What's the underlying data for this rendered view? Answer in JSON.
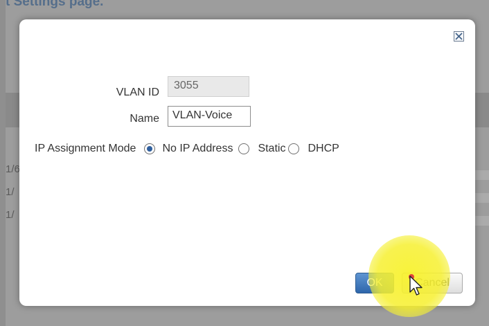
{
  "background": {
    "title_fragment": "t Settings page.",
    "row_fragments": [
      "1/6",
      "1/",
      "1/"
    ]
  },
  "dialog": {
    "vlan_id_label": "VLAN ID",
    "vlan_id_value": "3055",
    "name_label": "Name",
    "name_value": "VLAN-Voice",
    "ip_mode_label": "IP Assignment Mode",
    "ip_modes": [
      {
        "label": "No IP Address",
        "selected": true
      },
      {
        "label": "Static",
        "selected": false
      },
      {
        "label": "DHCP",
        "selected": false
      }
    ],
    "ok_label": "OK",
    "cancel_label": "Cancel"
  },
  "colors": {
    "accent": "#2e66ab",
    "highlight": "#f6f028"
  },
  "icons": {
    "close": "close-icon",
    "cursor": "mouse-pointer-icon"
  }
}
